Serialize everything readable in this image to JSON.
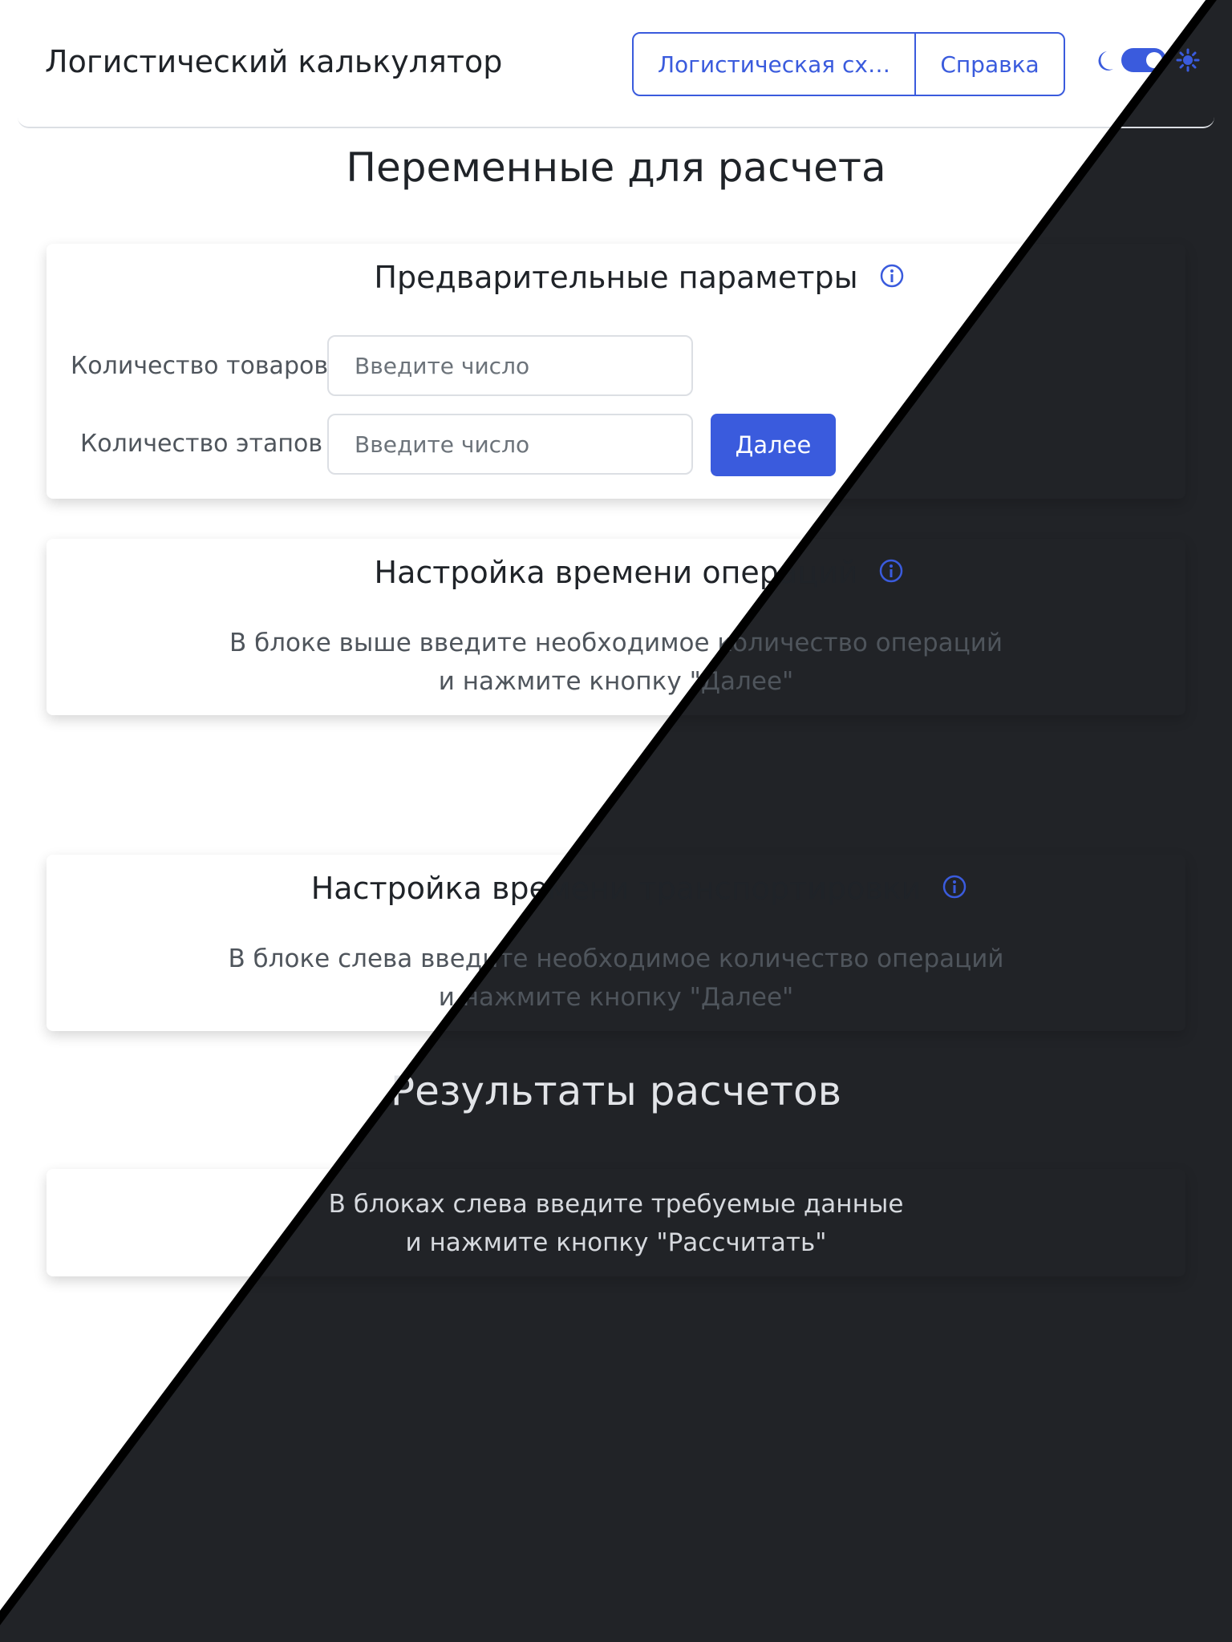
{
  "header": {
    "title": "Логистический калькулятор",
    "nav": {
      "scheme_label": "Логистическая схе...",
      "help_label": "Справка"
    },
    "theme_toggle": {
      "state": "on",
      "icons": [
        "moon-icon",
        "sun-icon"
      ]
    }
  },
  "variables": {
    "title": "Переменные для расчета",
    "pre_params": {
      "title": "Предварительные параметры",
      "goods_label": "Количество товаров",
      "goods_placeholder": "Введите число",
      "stages_label": "Количество этапов",
      "stages_placeholder": "Введите число",
      "next_label": "Далее"
    },
    "op_time": {
      "title": "Настройка времени операций",
      "line1": "В блоке выше введите необходимое количество операций",
      "line2": "и нажмите кнопку \"Далее\""
    },
    "transport_time": {
      "title": "Настройка времени транспортировки",
      "line1": "В блоке слева введите необходимое количество операций",
      "line2": "и нажмите кнопку \"Далее\""
    }
  },
  "results": {
    "title": "Результаты расчетов",
    "line1": "В блоках слева введите требуемые данные",
    "line2": "и нажмите кнопку \"Рассчитать\""
  },
  "colors": {
    "accent": "#3a5bdd",
    "dark_background": "#212327",
    "light_background": "#ffffff"
  }
}
